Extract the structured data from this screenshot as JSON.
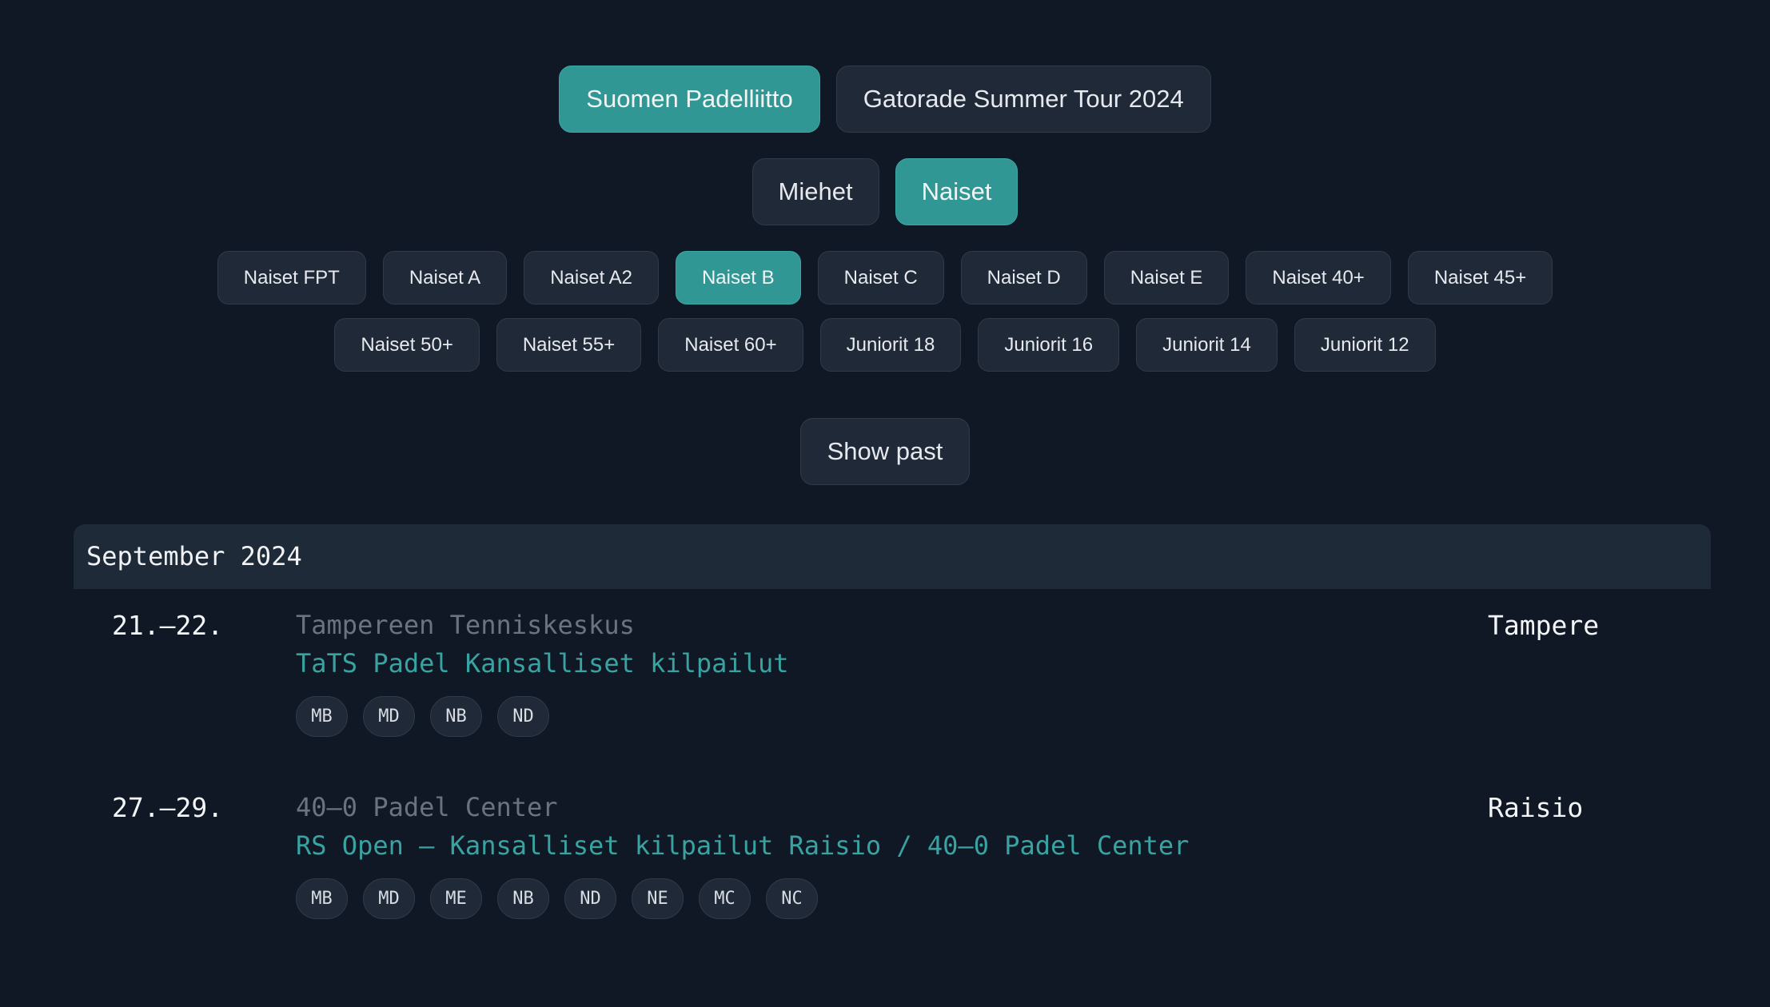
{
  "org_tabs": [
    {
      "label": "Suomen Padelliitto",
      "active": true
    },
    {
      "label": "Gatorade Summer Tour 2024",
      "active": false
    }
  ],
  "gender_tabs": [
    {
      "label": "Miehet",
      "active": false
    },
    {
      "label": "Naiset",
      "active": true
    }
  ],
  "categories_row1": [
    {
      "label": "Naiset FPT",
      "active": false
    },
    {
      "label": "Naiset A",
      "active": false
    },
    {
      "label": "Naiset A2",
      "active": false
    },
    {
      "label": "Naiset B",
      "active": true
    },
    {
      "label": "Naiset C",
      "active": false
    },
    {
      "label": "Naiset D",
      "active": false
    },
    {
      "label": "Naiset E",
      "active": false
    },
    {
      "label": "Naiset 40+",
      "active": false
    },
    {
      "label": "Naiset 45+",
      "active": false
    }
  ],
  "categories_row2": [
    {
      "label": "Naiset 50+",
      "active": false
    },
    {
      "label": "Naiset 55+",
      "active": false
    },
    {
      "label": "Naiset 60+",
      "active": false
    },
    {
      "label": "Juniorit 18",
      "active": false
    },
    {
      "label": "Juniorit 16",
      "active": false
    },
    {
      "label": "Juniorit 14",
      "active": false
    },
    {
      "label": "Juniorit 12",
      "active": false
    }
  ],
  "show_past_label": "Show past",
  "month": {
    "label": "September 2024"
  },
  "events": [
    {
      "date": "21.–22.",
      "venue": "Tampereen Tenniskeskus",
      "title": "TaTS Padel Kansalliset kilpailut",
      "city": "Tampere",
      "tags": [
        "MB",
        "MD",
        "NB",
        "ND"
      ]
    },
    {
      "date": "27.–29.",
      "venue": "40–0 Padel Center",
      "title": "RS Open – Kansalliset kilpailut Raisio / 40–0 Padel Center",
      "city": "Raisio",
      "tags": [
        "MB",
        "MD",
        "ME",
        "NB",
        "ND",
        "NE",
        "MC",
        "NC"
      ]
    }
  ]
}
